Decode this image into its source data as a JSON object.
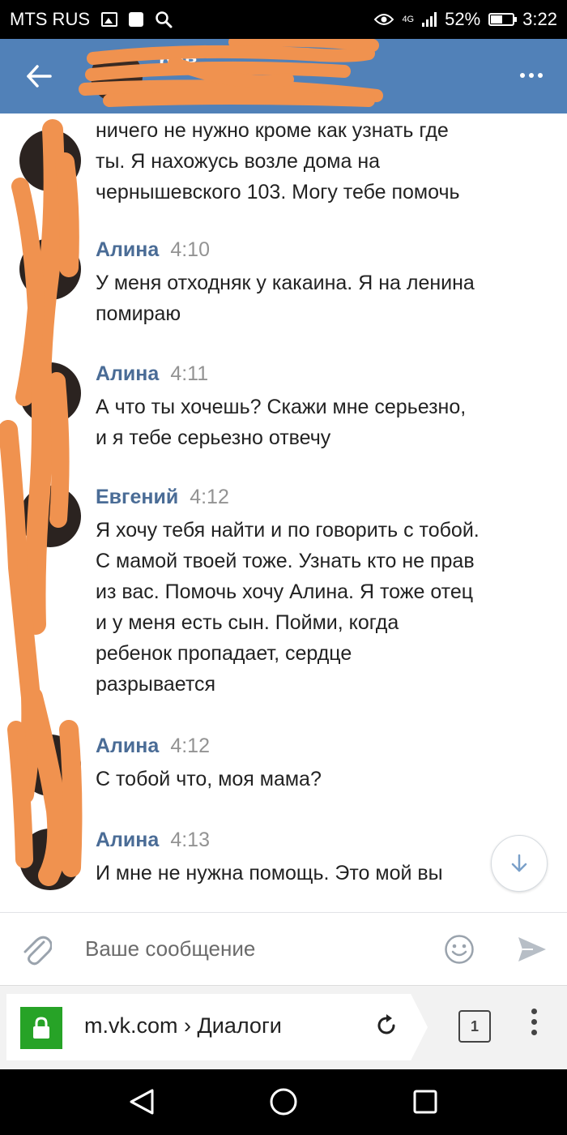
{
  "status_bar": {
    "carrier": "MTS RUS",
    "network": "4G",
    "battery_percent": "52%",
    "battery_level": 0.52,
    "time": "3:22",
    "icons": [
      "image-icon",
      "square-notification-icon",
      "search-icon",
      "eye-icon",
      "signal-icon",
      "battery-icon"
    ]
  },
  "header": {
    "title": "ров",
    "back_icon": "arrow-left-icon",
    "more_icon": "more-dots-icon"
  },
  "messages": [
    {
      "author": "",
      "time": "",
      "text": "ничего не нужно кроме как узнать где\nты. Я нахожусь возле дома на\nчернышевского 103. Могу тебе помочь"
    },
    {
      "author": "Алина",
      "time": "4:10",
      "text": "У меня отходняк у какаина. Я на ленина\nпомираю"
    },
    {
      "author": "Алина",
      "time": "4:11",
      "text": "А что ты хочешь? Скажи мне серьезно,\nи я тебе серьезно отвечу"
    },
    {
      "author": "Евгений",
      "time": "4:12",
      "text": "Я хочу тебя найти и по говорить с тобой.\nС мамой твоей тоже. Узнать кто не прав\nиз вас. Помочь хочу Алина. Я тоже отец\nи у меня есть сын. Пойми, когда\nребенок пропадает, сердце\nразрывается"
    },
    {
      "author": "Алина",
      "time": "4:12",
      "text": "С тобой что, моя мама?"
    },
    {
      "author": "Алина",
      "time": "4:13",
      "text": "И мне не нужна помощь. Это мой вы"
    }
  ],
  "scroll_down_icon": "arrow-down-icon",
  "composer": {
    "placeholder": "Ваше сообщение",
    "value": "",
    "attach_icon": "paperclip-icon",
    "emoji_icon": "smiley-icon",
    "send_icon": "send-icon"
  },
  "browser": {
    "url_display": "m.vk.com › Диалоги",
    "lock_icon": "lock-icon",
    "reload_icon": "reload-icon",
    "tab_count": "1",
    "menu_icon": "vertical-dots-icon"
  },
  "nav_bar": {
    "icons": [
      "back-triangle-icon",
      "home-circle-icon",
      "recents-square-icon"
    ]
  },
  "colors": {
    "header_bg": "#5181b8",
    "author_name": "#4a6c96",
    "timestamp": "#939393",
    "redaction": "#f0924f",
    "lock_green": "#27a327"
  }
}
